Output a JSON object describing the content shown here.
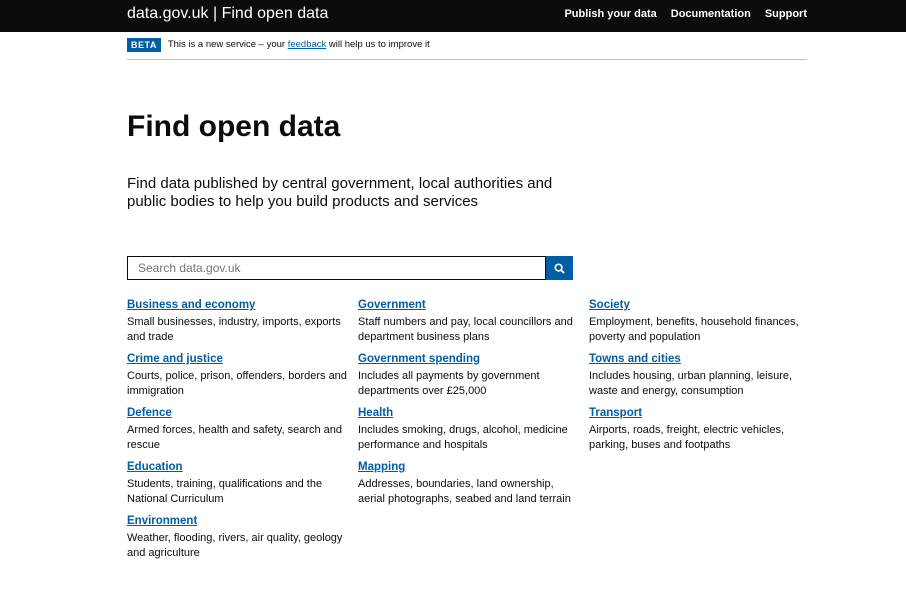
{
  "header": {
    "brand": "data.gov.uk | Find open data",
    "nav": [
      "Publish your data",
      "Documentation",
      "Support"
    ]
  },
  "beta": {
    "tag": "BETA",
    "text_before": "This is a new service – your ",
    "link": "feedback",
    "text_after": " will help us to improve it"
  },
  "main": {
    "title": "Find open data",
    "lede": "Find data published by central government, local authorities and public bodies to help you build products and services",
    "search": {
      "placeholder": "Search data.gov.uk",
      "icon": "search-icon"
    }
  },
  "topics": [
    [
      {
        "title": "Business and economy",
        "desc": "Small businesses, industry, imports, exports and trade"
      },
      {
        "title": "Crime and justice",
        "desc": "Courts, police, prison, offenders, borders and immigration"
      },
      {
        "title": "Defence",
        "desc": "Armed forces, health and safety, search and rescue"
      },
      {
        "title": "Education",
        "desc": "Students, training, qualifications and the National Curriculum"
      },
      {
        "title": "Environment",
        "desc": "Weather, flooding, rivers, air quality, geology and agriculture"
      }
    ],
    [
      {
        "title": "Government",
        "desc": "Staff numbers and pay, local councillors and department business plans"
      },
      {
        "title": "Government spending",
        "desc": "Includes all payments by government departments over £25,000"
      },
      {
        "title": "Health",
        "desc": "Includes smoking, drugs, alcohol, medicine performance and hospitals"
      },
      {
        "title": "Mapping",
        "desc": "Addresses, boundaries, land ownership, aerial photographs, seabed and land terrain"
      }
    ],
    [
      {
        "title": "Society",
        "desc": "Employment, benefits, household finances, poverty and population"
      },
      {
        "title": "Towns and cities",
        "desc": "Includes housing, urban planning, leisure, waste and energy, consumption"
      },
      {
        "title": "Transport",
        "desc": "Airports, roads, freight, electric vehicles, parking, buses and footpaths"
      }
    ]
  ],
  "colors": {
    "link": "#005ea5",
    "header_bg": "#0b0c0c",
    "text": "#0b0c0c"
  }
}
